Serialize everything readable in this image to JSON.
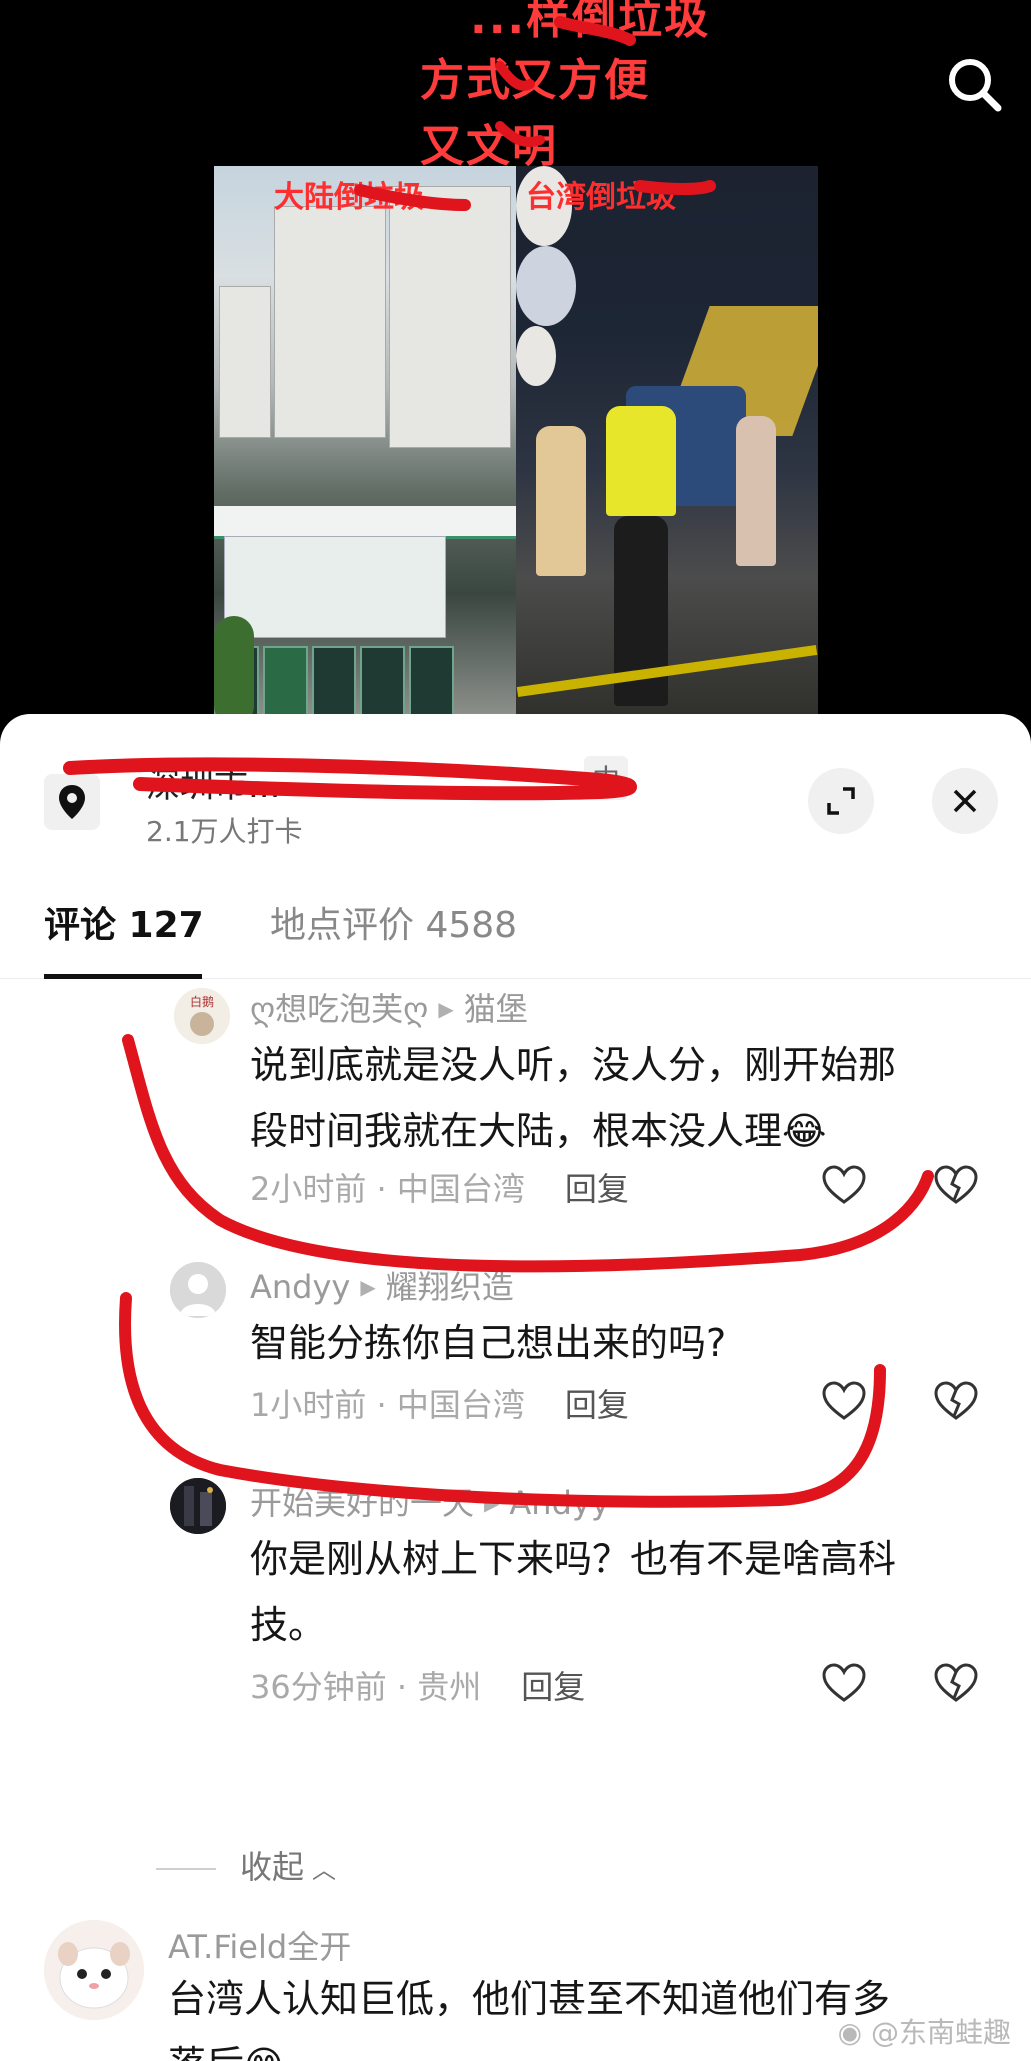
{
  "video": {
    "caption_lines": [
      "...样倒垃圾",
      "方式又方便",
      "又文明"
    ],
    "left_label": "大陆倒垃圾",
    "right_label": "台湾倒垃圾"
  },
  "location": {
    "name": "深圳市...",
    "tag": "中",
    "checkins": "2.1万人打卡"
  },
  "tabs": {
    "comments": "评论 127",
    "place_reviews": "地点评价 4588"
  },
  "comments": [
    {
      "user": "ღ想吃泡芙ღ",
      "reply_to": "猫堡",
      "text_line1": "说到底就是没人听，没人分，刚开始那",
      "text_line2": "段时间我就在大陆，根本没人理",
      "emoji": "😂",
      "time_loc": "2小时前 · 中国台湾",
      "reply": "回复"
    },
    {
      "user": "Andyy",
      "reply_to": "耀翔织造",
      "text_line1": "智能分拣你自己想出来的吗?",
      "time_loc": "1小时前 · 中国台湾",
      "reply": "回复"
    },
    {
      "user": "开始美好的一天",
      "reply_to": "Andyy",
      "text_line1": "你是刚从树上下来吗？也有不是啥高科",
      "text_line2": "技。",
      "time_loc": "36分钟前 · 贵州",
      "reply": "回复"
    },
    {
      "user": "AT.Field全开",
      "text_line1": "台湾人认知巨低，他们甚至不知道他们有多",
      "text_line2": "落后",
      "emoji": "😁"
    }
  ],
  "collapse_label": "收起",
  "watermark": "@东南蛙趣",
  "colors": {
    "annotation_red": "#e0141c",
    "caption_red": "#ff3b3b",
    "muted_text": "#a9a9a9"
  }
}
